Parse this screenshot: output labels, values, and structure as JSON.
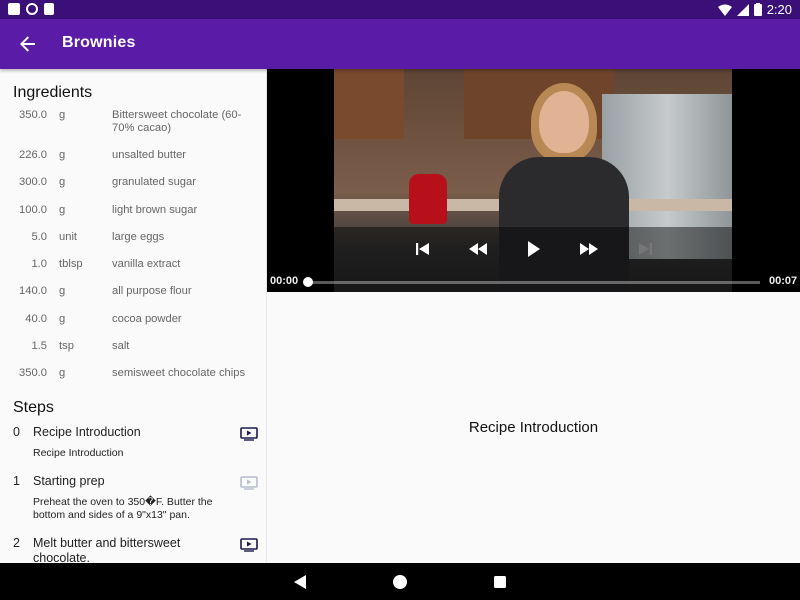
{
  "status_bar": {
    "time": "2:20"
  },
  "app_bar": {
    "title": "Brownies"
  },
  "ingredients": {
    "title": "Ingredients",
    "items": [
      {
        "qty": "350.0",
        "unit": "g",
        "name": "Bittersweet chocolate (60-70% cacao)"
      },
      {
        "qty": "226.0",
        "unit": "g",
        "name": "unsalted butter"
      },
      {
        "qty": "300.0",
        "unit": "g",
        "name": "granulated sugar"
      },
      {
        "qty": "100.0",
        "unit": "g",
        "name": "light brown sugar"
      },
      {
        "qty": "5.0",
        "unit": "unit",
        "name": "large eggs"
      },
      {
        "qty": "1.0",
        "unit": "tblsp",
        "name": "vanilla extract"
      },
      {
        "qty": "140.0",
        "unit": "g",
        "name": "all purpose flour"
      },
      {
        "qty": "40.0",
        "unit": "g",
        "name": "cocoa powder"
      },
      {
        "qty": "1.5",
        "unit": "tsp",
        "name": "salt"
      },
      {
        "qty": "350.0",
        "unit": "g",
        "name": "semisweet chocolate chips"
      }
    ]
  },
  "steps": {
    "title": "Steps",
    "items": [
      {
        "num": "0",
        "title": "Recipe Introduction",
        "desc": "Recipe Introduction",
        "has_video": true
      },
      {
        "num": "1",
        "title": "Starting prep",
        "desc": "Preheat the oven to 350�F. Butter the bottom and sides of a 9\"x13\" pan.",
        "has_video": false
      },
      {
        "num": "2",
        "title": "Melt butter and bittersweet chocolate.",
        "desc": "",
        "has_video": true
      }
    ]
  },
  "player": {
    "position": "00:00",
    "duration": "00:07",
    "progress": 0.0
  },
  "step_detail": {
    "description": "Recipe Introduction"
  },
  "colors": {
    "status_bar": "#3a1078",
    "app_bar": "#5a1ba6",
    "play_icon_active": "#1a1a4a",
    "play_icon_disabled": "#b8bdd0"
  }
}
